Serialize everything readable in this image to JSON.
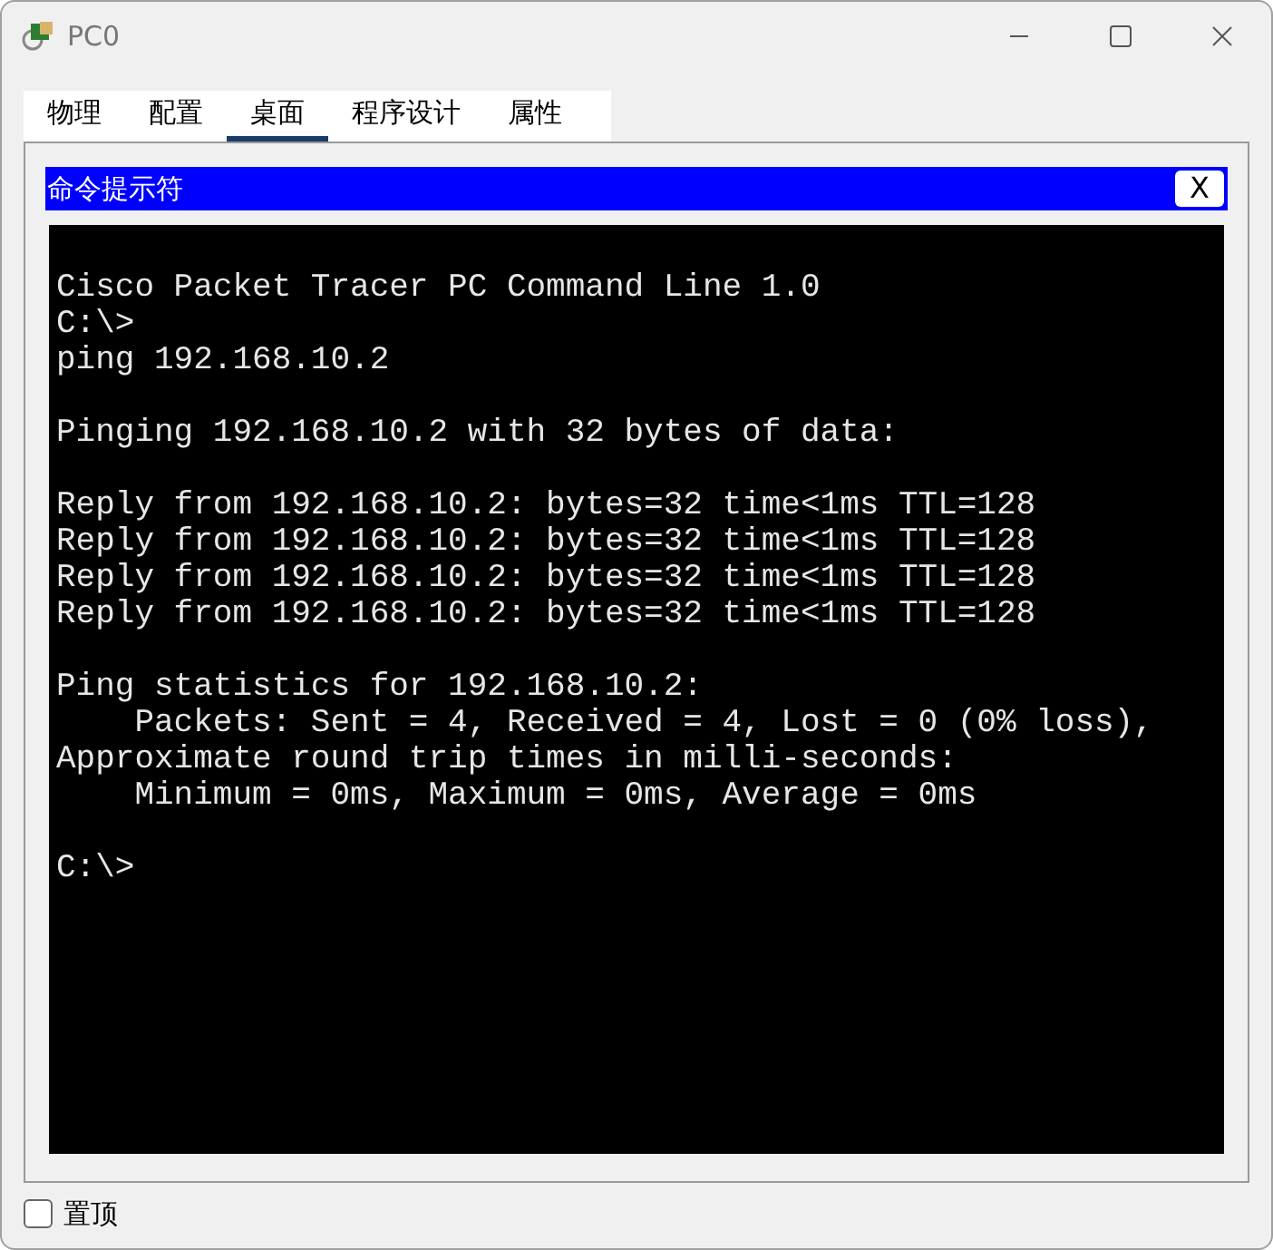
{
  "window": {
    "title": "PC0"
  },
  "tabs": [
    {
      "label": "物理",
      "selected": false
    },
    {
      "label": "配置",
      "selected": false
    },
    {
      "label": "桌面",
      "selected": true
    },
    {
      "label": "程序设计",
      "selected": false
    },
    {
      "label": "属性",
      "selected": false
    }
  ],
  "command_prompt": {
    "title": "命令提示符",
    "close_label": "X",
    "blocks": [
      [
        "Cisco Packet Tracer PC Command Line 1.0",
        "C:\\>",
        "ping 192.168.10.2"
      ],
      [
        "Pinging 192.168.10.2 with 32 bytes of data:"
      ],
      [
        "Reply from 192.168.10.2: bytes=32 time<1ms TTL=128",
        "Reply from 192.168.10.2: bytes=32 time<1ms TTL=128",
        "Reply from 192.168.10.2: bytes=32 time<1ms TTL=128",
        "Reply from 192.168.10.2: bytes=32 time<1ms TTL=128"
      ],
      [
        "Ping statistics for 192.168.10.2:",
        "    Packets: Sent = 4, Received = 4, Lost = 0 (0% loss),",
        "Approximate round trip times in milli-seconds:",
        "    Minimum = 0ms, Maximum = 0ms, Average = 0ms"
      ],
      [
        "C:\\>"
      ]
    ]
  },
  "always_on_top": {
    "label": "置顶",
    "checked": false
  }
}
